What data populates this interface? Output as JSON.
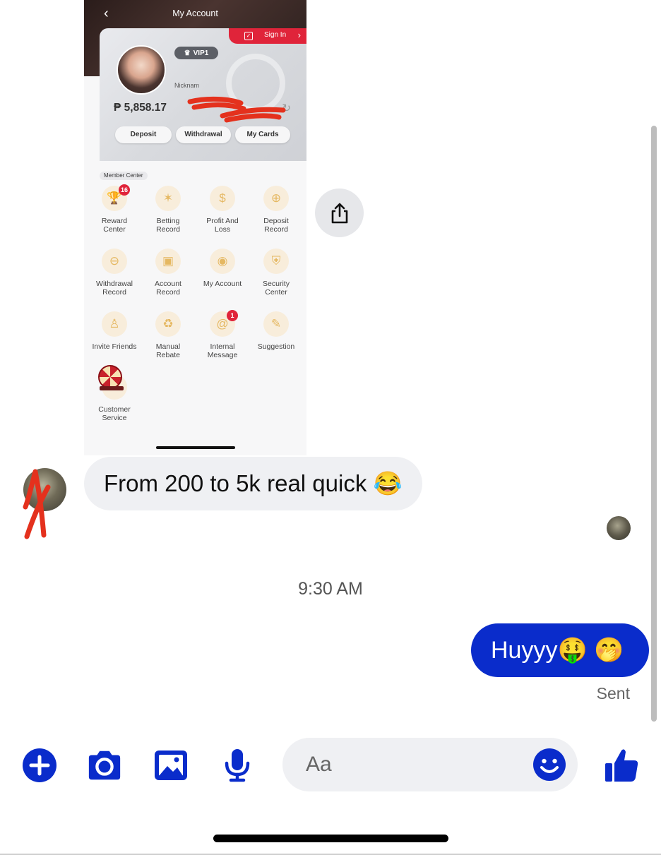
{
  "screenshot": {
    "title": "My Account",
    "sign_in": "Sign In",
    "vip": "VIP1",
    "nickname": "Nicknam",
    "balance": "₱ 5,858.17",
    "buttons": [
      "Deposit",
      "Withdrawal",
      "My Cards"
    ],
    "member_center": "Member Center",
    "items": [
      {
        "label1": "Reward",
        "label2": "Center",
        "icon": "trophy-icon",
        "badge": "16"
      },
      {
        "label1": "Betting",
        "label2": "Record",
        "icon": "star-icon",
        "badge": ""
      },
      {
        "label1": "Profit And",
        "label2": "Loss",
        "icon": "dollar-doc-icon",
        "badge": ""
      },
      {
        "label1": "Deposit",
        "label2": "Record",
        "icon": "deposit-doc-icon",
        "badge": ""
      },
      {
        "label1": "Withdrawal",
        "label2": "Record",
        "icon": "withdraw-doc-icon",
        "badge": ""
      },
      {
        "label1": "Account",
        "label2": "Record",
        "icon": "account-record-icon",
        "badge": ""
      },
      {
        "label1": "My Account",
        "label2": "",
        "icon": "user-icon",
        "badge": ""
      },
      {
        "label1": "Security",
        "label2": "Center",
        "icon": "shield-icon",
        "badge": ""
      },
      {
        "label1": "Invite Friends",
        "label2": "",
        "icon": "invite-icon",
        "badge": ""
      },
      {
        "label1": "Manual",
        "label2": "Rebate",
        "icon": "rebate-icon",
        "badge": ""
      },
      {
        "label1": "Internal",
        "label2": "Message",
        "icon": "at-icon",
        "badge": "1"
      },
      {
        "label1": "Suggestion",
        "label2": "",
        "icon": "suggestion-icon",
        "badge": ""
      },
      {
        "label1": "Customer",
        "label2": "Service",
        "icon": "headset-icon",
        "badge": ""
      }
    ]
  },
  "received_message": "From 200 to 5k real quick 😂",
  "timestamp": "9:30 AM",
  "sent_message": "Huyyy🤑 🤭",
  "sent_status": "Sent",
  "composer": {
    "placeholder": "Aa"
  },
  "colors": {
    "accent": "#0a2ccb",
    "bubble_gray": "#eff0f3",
    "badge_red": "#e0243a"
  }
}
